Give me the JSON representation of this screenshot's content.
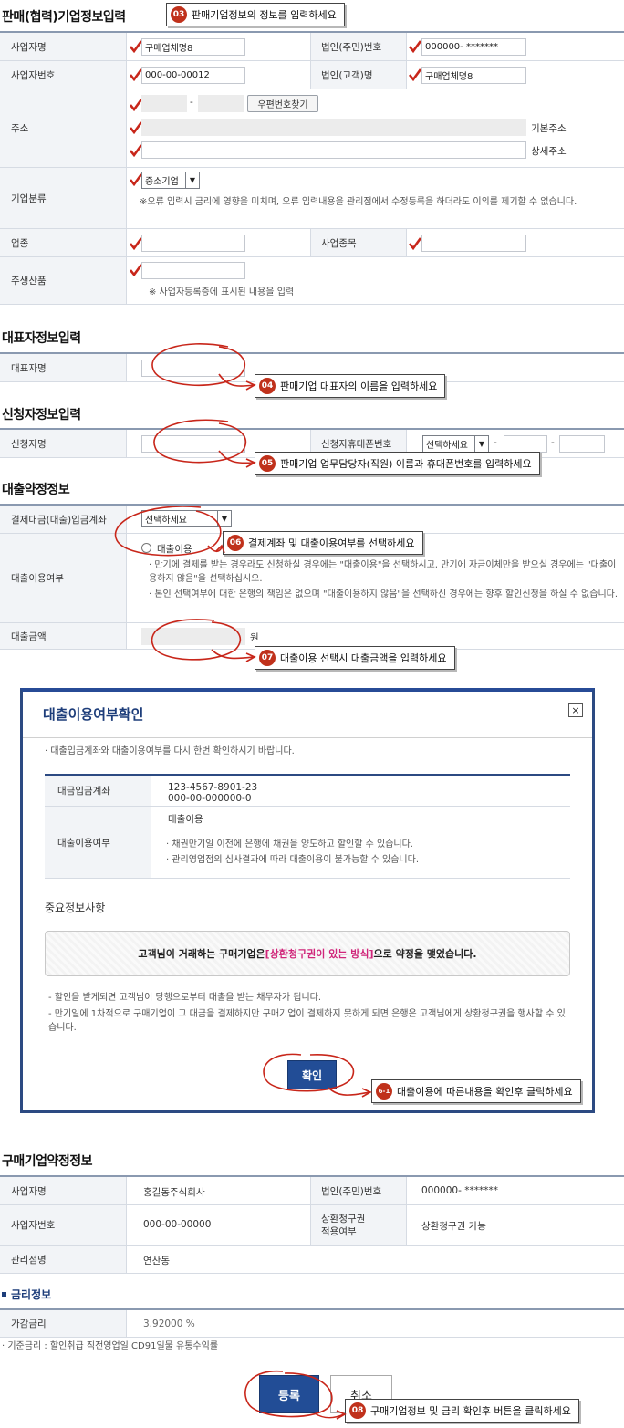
{
  "section1": {
    "title": "판매(협력)기업정보입력",
    "callout_num": "03",
    "callout": "판매기업정보의 정보를 입력하세요",
    "rows": {
      "business_name_label": "사업자명",
      "business_name_value": "구매업체명8",
      "corp_no_label": "법인(주민)번호",
      "corp_no_value": "000000- *******",
      "biz_reg_label": "사업자번호",
      "biz_reg_value": "000-00-00012",
      "corp_name_label": "법인(고객)명",
      "corp_name_value": "구매업체명8",
      "address_label": "주소",
      "zip_button": "우편번호찾기",
      "zip_dash": "-",
      "basic_address": "기본주소",
      "detail_address": "상세주소",
      "category_label": "기업분류",
      "category_value": "중소기업",
      "category_note": "※오류 입력시 금리에 영향을 미치며, 오류 입력내용을 관리점에서 수정등록을 하더라도 이의를 제기할 수 없습니다.",
      "industry_label": "업종",
      "biz_type_label": "사업종목",
      "main_product_label": "주생산품",
      "main_product_note": "※ 사업자등록증에 표시된 내용을 입력"
    }
  },
  "section2": {
    "title": "대표자정보입력",
    "rep_label": "대표자명",
    "callout_num": "04",
    "callout": "판매기업 대표자의 이름을 입력하세요"
  },
  "section3": {
    "title": "신청자정보입력",
    "applicant_label": "신청자명",
    "phone_label": "신청자휴대폰번호",
    "phone_select": "선택하세요",
    "dash": "-",
    "callout_num": "05",
    "callout": "판매기업  업무담당자(직원) 이름과 휴대폰번호를 입력하세요"
  },
  "section4": {
    "title": "대출약정정보",
    "account_label": "결제대금(대출)입금계좌",
    "account_select": "선택하세요",
    "callout6_num": "06",
    "callout6": "결제계좌 및 대출이용여부를 선택하세요",
    "loan_use_label": "대출이용여부",
    "radio_label": "대출이용",
    "loan_note1": "· 만기에 결제를 받는 경우라도 신청하실 경우에는 \"대출이용\"을 선택하시고, 만기에 자금이체만을 받으실 경우에는 \"대출이용하지 않음\"을 선택하십시오.",
    "loan_note2": "· 본인 선택여부에 대한 은행의 책임은 없으며 \"대출이용하지 않음\"을 선택하신 경우에는 향후 할인신청을 하실 수 없습니다.",
    "amount_label": "대출금액",
    "amount_unit": "원",
    "callout7_num": "07",
    "callout7": "대출이용 선택시 대출금액을 입력하세요"
  },
  "modal": {
    "title": "대출이용여부확인",
    "close": "×",
    "intro": "· 대출입금계좌와 대출이용여부를 다시 한번 확인하시기 바랍니다.",
    "account_label": "대금입금계좌",
    "account_line1": "123-4567-8901-23",
    "account_line2": "000-00-000000-0",
    "loan_label": "대출이용여부",
    "loan_value": "대출이용",
    "loan_bullet1": "· 채권만기일 이전에 은행에 채권을 양도하고 할인할 수 있습니다.",
    "loan_bullet2": "· 관리영업점의 심사결과에 따라 대출이용이 불가능할 수 있습니다.",
    "important_title": "중요정보사항",
    "notice_pre": "고객님이 거래하는 구매기업은 ",
    "notice_highlight": "[상환청구권이 있는 방식]",
    "notice_post": " 으로 약정을 맺었습니다.",
    "note1": "- 할인을 받게되면 고객님이 당행으로부터 대출을 받는 채무자가 됩니다.",
    "note2": "- 만기일에 1차적으로 구매기업이 그 대금을 결제하지만 구매기업이 결제하지 못하게 되면 은행은 고객님에게 상환청구권을 행사할 수 있습니다.",
    "confirm_button": "확인",
    "callout_num": "6-1",
    "callout": "대출이용에 따른내용을 확인후 클릭하세요"
  },
  "section5": {
    "title": "구매기업약정정보",
    "biz_name_label": "사업자명",
    "biz_name_value": "홍길동주식회사",
    "corp_no_label": "법인(주민)번호",
    "corp_no_value": "000000- *******",
    "biz_reg_label": "사업자번호",
    "biz_reg_value": "000-00-00000",
    "recourse_label_1": "상환청구권",
    "recourse_label_2": "적용여부",
    "recourse_value": "상환청구권 가능",
    "branch_label": "관리점명",
    "branch_value": "연산동"
  },
  "section6": {
    "title": "금리정보",
    "rate_label": "가감금리",
    "rate_value": "3.92000 %",
    "rate_note": "· 기준금리 : 할인취급 직전영업일 CD91일물 유통수익률"
  },
  "actions": {
    "submit": "등록",
    "cancel": "취소",
    "callout_num": "08",
    "callout": "구매기업정보 및 금리 확인후 버튼을 클릭하세요"
  },
  "colors": {
    "badge": "#c0311b",
    "check": "#c8261a",
    "header_bg": "#f2f4f7",
    "modal_border": "#2c4a82",
    "primary_button": "#224d96",
    "highlight_text": "#d0267a"
  }
}
